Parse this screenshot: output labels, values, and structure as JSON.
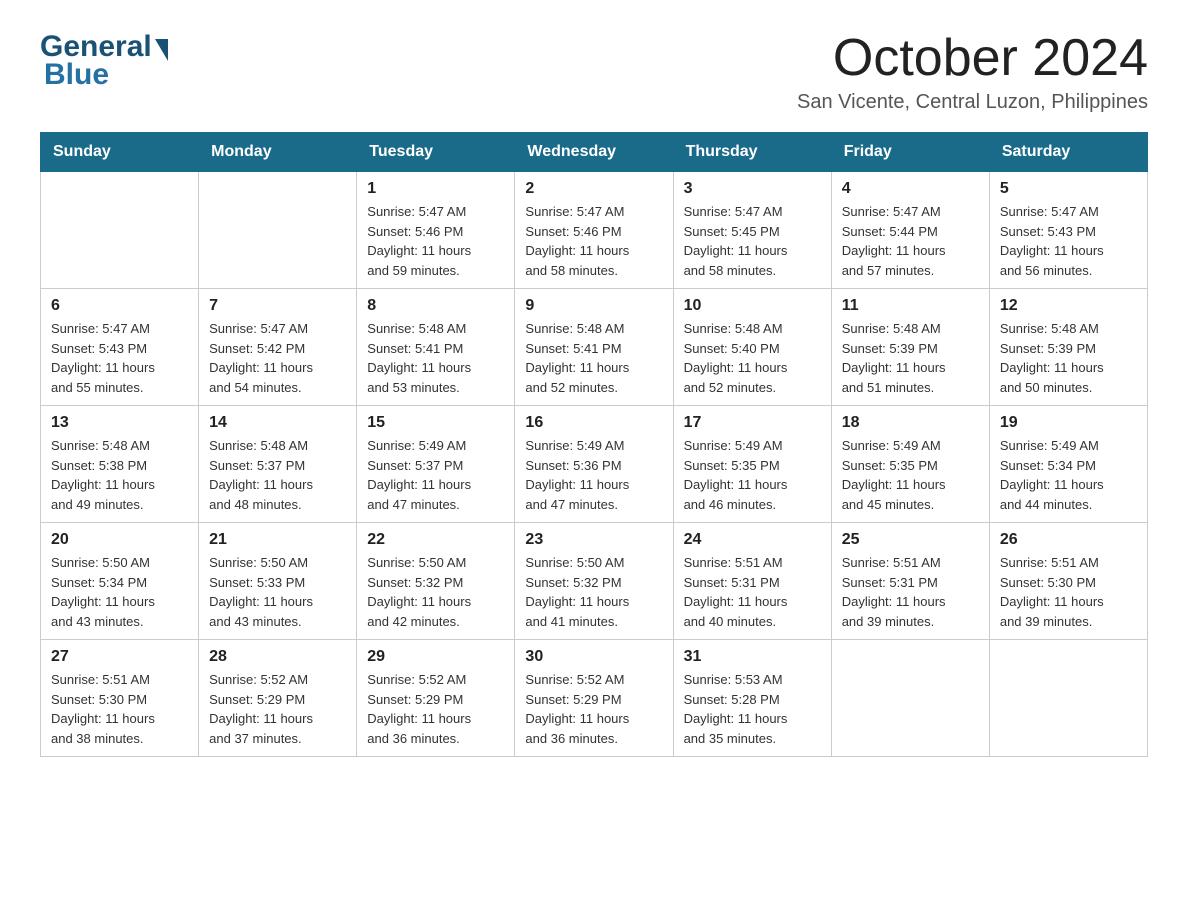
{
  "logo": {
    "general": "General",
    "blue": "Blue"
  },
  "title": {
    "month_year": "October 2024",
    "location": "San Vicente, Central Luzon, Philippines"
  },
  "calendar": {
    "headers": [
      "Sunday",
      "Monday",
      "Tuesday",
      "Wednesday",
      "Thursday",
      "Friday",
      "Saturday"
    ],
    "weeks": [
      [
        {
          "day": "",
          "info": ""
        },
        {
          "day": "",
          "info": ""
        },
        {
          "day": "1",
          "info": "Sunrise: 5:47 AM\nSunset: 5:46 PM\nDaylight: 11 hours\nand 59 minutes."
        },
        {
          "day": "2",
          "info": "Sunrise: 5:47 AM\nSunset: 5:46 PM\nDaylight: 11 hours\nand 58 minutes."
        },
        {
          "day": "3",
          "info": "Sunrise: 5:47 AM\nSunset: 5:45 PM\nDaylight: 11 hours\nand 58 minutes."
        },
        {
          "day": "4",
          "info": "Sunrise: 5:47 AM\nSunset: 5:44 PM\nDaylight: 11 hours\nand 57 minutes."
        },
        {
          "day": "5",
          "info": "Sunrise: 5:47 AM\nSunset: 5:43 PM\nDaylight: 11 hours\nand 56 minutes."
        }
      ],
      [
        {
          "day": "6",
          "info": "Sunrise: 5:47 AM\nSunset: 5:43 PM\nDaylight: 11 hours\nand 55 minutes."
        },
        {
          "day": "7",
          "info": "Sunrise: 5:47 AM\nSunset: 5:42 PM\nDaylight: 11 hours\nand 54 minutes."
        },
        {
          "day": "8",
          "info": "Sunrise: 5:48 AM\nSunset: 5:41 PM\nDaylight: 11 hours\nand 53 minutes."
        },
        {
          "day": "9",
          "info": "Sunrise: 5:48 AM\nSunset: 5:41 PM\nDaylight: 11 hours\nand 52 minutes."
        },
        {
          "day": "10",
          "info": "Sunrise: 5:48 AM\nSunset: 5:40 PM\nDaylight: 11 hours\nand 52 minutes."
        },
        {
          "day": "11",
          "info": "Sunrise: 5:48 AM\nSunset: 5:39 PM\nDaylight: 11 hours\nand 51 minutes."
        },
        {
          "day": "12",
          "info": "Sunrise: 5:48 AM\nSunset: 5:39 PM\nDaylight: 11 hours\nand 50 minutes."
        }
      ],
      [
        {
          "day": "13",
          "info": "Sunrise: 5:48 AM\nSunset: 5:38 PM\nDaylight: 11 hours\nand 49 minutes."
        },
        {
          "day": "14",
          "info": "Sunrise: 5:48 AM\nSunset: 5:37 PM\nDaylight: 11 hours\nand 48 minutes."
        },
        {
          "day": "15",
          "info": "Sunrise: 5:49 AM\nSunset: 5:37 PM\nDaylight: 11 hours\nand 47 minutes."
        },
        {
          "day": "16",
          "info": "Sunrise: 5:49 AM\nSunset: 5:36 PM\nDaylight: 11 hours\nand 47 minutes."
        },
        {
          "day": "17",
          "info": "Sunrise: 5:49 AM\nSunset: 5:35 PM\nDaylight: 11 hours\nand 46 minutes."
        },
        {
          "day": "18",
          "info": "Sunrise: 5:49 AM\nSunset: 5:35 PM\nDaylight: 11 hours\nand 45 minutes."
        },
        {
          "day": "19",
          "info": "Sunrise: 5:49 AM\nSunset: 5:34 PM\nDaylight: 11 hours\nand 44 minutes."
        }
      ],
      [
        {
          "day": "20",
          "info": "Sunrise: 5:50 AM\nSunset: 5:34 PM\nDaylight: 11 hours\nand 43 minutes."
        },
        {
          "day": "21",
          "info": "Sunrise: 5:50 AM\nSunset: 5:33 PM\nDaylight: 11 hours\nand 43 minutes."
        },
        {
          "day": "22",
          "info": "Sunrise: 5:50 AM\nSunset: 5:32 PM\nDaylight: 11 hours\nand 42 minutes."
        },
        {
          "day": "23",
          "info": "Sunrise: 5:50 AM\nSunset: 5:32 PM\nDaylight: 11 hours\nand 41 minutes."
        },
        {
          "day": "24",
          "info": "Sunrise: 5:51 AM\nSunset: 5:31 PM\nDaylight: 11 hours\nand 40 minutes."
        },
        {
          "day": "25",
          "info": "Sunrise: 5:51 AM\nSunset: 5:31 PM\nDaylight: 11 hours\nand 39 minutes."
        },
        {
          "day": "26",
          "info": "Sunrise: 5:51 AM\nSunset: 5:30 PM\nDaylight: 11 hours\nand 39 minutes."
        }
      ],
      [
        {
          "day": "27",
          "info": "Sunrise: 5:51 AM\nSunset: 5:30 PM\nDaylight: 11 hours\nand 38 minutes."
        },
        {
          "day": "28",
          "info": "Sunrise: 5:52 AM\nSunset: 5:29 PM\nDaylight: 11 hours\nand 37 minutes."
        },
        {
          "day": "29",
          "info": "Sunrise: 5:52 AM\nSunset: 5:29 PM\nDaylight: 11 hours\nand 36 minutes."
        },
        {
          "day": "30",
          "info": "Sunrise: 5:52 AM\nSunset: 5:29 PM\nDaylight: 11 hours\nand 36 minutes."
        },
        {
          "day": "31",
          "info": "Sunrise: 5:53 AM\nSunset: 5:28 PM\nDaylight: 11 hours\nand 35 minutes."
        },
        {
          "day": "",
          "info": ""
        },
        {
          "day": "",
          "info": ""
        }
      ]
    ]
  }
}
